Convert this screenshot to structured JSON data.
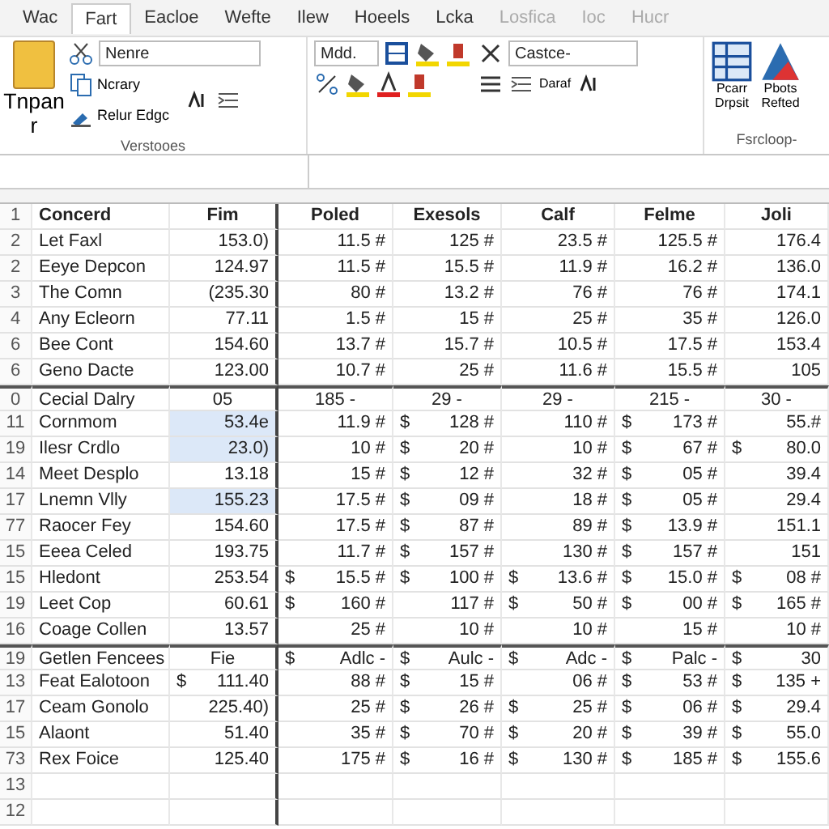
{
  "ribbon_tabs": [
    {
      "label": "Wac",
      "selected": false,
      "disabled": false
    },
    {
      "label": "Fart",
      "selected": true,
      "disabled": false
    },
    {
      "label": "Eacloe",
      "selected": false,
      "disabled": false
    },
    {
      "label": "Wefte",
      "selected": false,
      "disabled": false
    },
    {
      "label": "Ilew",
      "selected": false,
      "disabled": false
    },
    {
      "label": "Hoeels",
      "selected": false,
      "disabled": false
    },
    {
      "label": "Lcka",
      "selected": false,
      "disabled": false
    },
    {
      "label": "Losfica",
      "selected": false,
      "disabled": true
    },
    {
      "label": "Ioc",
      "selected": false,
      "disabled": true
    },
    {
      "label": "Hucr",
      "selected": false,
      "disabled": true
    }
  ],
  "ribbon": {
    "paste_label": "Tnpan",
    "paste_caret": "r",
    "clipboard_items": [
      "Ncrary",
      "Relur Edgc"
    ],
    "font_name": "Nenre",
    "font_size": "Mdd.",
    "number_format": "Castce-",
    "format_button": "Daraf",
    "right_buttons": [
      {
        "line1": "Pcarr",
        "line2": "Drpsit"
      },
      {
        "line1": "Pbots",
        "line2": "Refted"
      }
    ],
    "group_labels": [
      "Verstooes",
      "Fsrcloop-"
    ]
  },
  "sheet": {
    "rows": [
      {
        "kind": "header",
        "num": "1",
        "name": "Concerd",
        "amount": "Fim",
        "values": [
          "Poled",
          "Exesols",
          "Calf",
          "Felme",
          "Joli"
        ]
      },
      {
        "kind": "data",
        "num": "2",
        "name": "Let Faxl",
        "amount": "153.0)",
        "values": [
          "11.5 #",
          "125 #",
          "23.5 #",
          "125.5 #",
          "176.4"
        ]
      },
      {
        "kind": "data",
        "num": "2",
        "name": "Eeye Depcon",
        "amount": "124.97",
        "values": [
          "11.5 #",
          "15.5 #",
          "11.9 #",
          "16.2 #",
          "136.0"
        ]
      },
      {
        "kind": "data",
        "num": "3",
        "name": "The Comn",
        "amount": "(235.30",
        "values": [
          "80 #",
          "13.2 #",
          "76 #",
          "76 #",
          "174.1"
        ]
      },
      {
        "kind": "data",
        "num": "4",
        "name": "Any Ecleorn",
        "amount": "77.11",
        "values": [
          "1.5 #",
          "15 #",
          "25 #",
          "35 #",
          "126.0"
        ]
      },
      {
        "kind": "data",
        "num": "6",
        "name": "Bee Cont",
        "amount": "154.60",
        "values": [
          "13.7 #",
          "15.7 #",
          "10.5 #",
          "17.5 #",
          "153.4"
        ]
      },
      {
        "kind": "data",
        "num": "6",
        "name": "Geno Dacte",
        "amount": "123.00",
        "values": [
          "10.7 #",
          "25 #",
          "11.6 #",
          "15.5 #",
          "105"
        ]
      },
      {
        "kind": "section",
        "num": "0",
        "name": "Cecial Dalry",
        "amount": "05",
        "values": [
          "185 -",
          "29 -",
          "29 -",
          "215 -",
          "30 -"
        ]
      },
      {
        "kind": "data",
        "num": "11",
        "name": "Cornmom",
        "amount": "53.4e",
        "amount_selected": true,
        "values": [
          "11.9 #",
          {
            "prefix": "$",
            "text": "128 #"
          },
          "110 #",
          {
            "prefix": "$",
            "text": "173 #"
          },
          "55.#"
        ]
      },
      {
        "kind": "data",
        "num": "19",
        "name": "Ilesr Crdlo",
        "amount": "23.0)",
        "amount_selected": true,
        "values": [
          "10 #",
          {
            "prefix": "$",
            "text": "20 #"
          },
          "10 #",
          {
            "prefix": "$",
            "text": "67 #"
          },
          {
            "prefix": "$",
            "text": "80.0"
          }
        ]
      },
      {
        "kind": "data",
        "num": "14",
        "name": "Meet Desplo",
        "amount": "13.18",
        "amount_selected": false,
        "values": [
          "15 #",
          {
            "prefix": "$",
            "text": "12 #"
          },
          "32 #",
          {
            "prefix": "$",
            "text": "05 #"
          },
          "39.4"
        ]
      },
      {
        "kind": "data",
        "num": "17",
        "name": "Lnemn Vlly",
        "amount": "155.23",
        "amount_selected": true,
        "values": [
          "17.5 #",
          {
            "prefix": "$",
            "text": "09 #"
          },
          "18 #",
          {
            "prefix": "$",
            "text": "05 #"
          },
          "29.4"
        ]
      },
      {
        "kind": "data",
        "num": "77",
        "name": "Raocer Fey",
        "amount": "154.60",
        "amount_selected": false,
        "values": [
          "17.5 #",
          {
            "prefix": "$",
            "text": "87 #"
          },
          "89 #",
          {
            "prefix": "$",
            "text": "13.9 #"
          },
          "151.1"
        ]
      },
      {
        "kind": "data",
        "num": "15",
        "name": "Eeea Celed",
        "amount": "193.75",
        "amount_selected": false,
        "values": [
          "11.7 #",
          {
            "prefix": "$",
            "text": "157 #"
          },
          "130 #",
          {
            "prefix": "$",
            "text": "157 #"
          },
          "151"
        ]
      },
      {
        "kind": "data",
        "num": "15",
        "name": "Hledont",
        "amount": "253.54",
        "amount_selected": false,
        "values": [
          {
            "prefix": "$",
            "text": "15.5 #"
          },
          {
            "prefix": "$",
            "text": "100 #"
          },
          {
            "prefix": "$",
            "text": "13.6 #"
          },
          {
            "prefix": "$",
            "text": "15.0 #"
          },
          {
            "prefix": "$",
            "text": "08 #"
          }
        ]
      },
      {
        "kind": "data",
        "num": "19",
        "name": "Leet Cop",
        "amount": "60.61",
        "amount_selected": false,
        "values": [
          {
            "prefix": "$",
            "text": "160 #"
          },
          "117 #",
          {
            "prefix": "$",
            "text": "50 #"
          },
          {
            "prefix": "$",
            "text": "00 #"
          },
          {
            "prefix": "$",
            "text": "165 #"
          }
        ]
      },
      {
        "kind": "data",
        "num": "16",
        "name": "Coage Collen",
        "amount": "13.57",
        "amount_selected": false,
        "values": [
          "25 #",
          "10 #",
          "10 #",
          "15 #",
          "10 #"
        ]
      },
      {
        "kind": "subheader",
        "num": "19",
        "name": "Getlen Fencees",
        "amount": "Fie",
        "values": [
          {
            "prefix": "$",
            "text": "Adlc -"
          },
          {
            "prefix": "$",
            "text": "Aulc -"
          },
          {
            "prefix": "$",
            "text": "Adc -"
          },
          {
            "prefix": "$",
            "text": "Palc -"
          },
          {
            "prefix": "$",
            "text": "30"
          }
        ]
      },
      {
        "kind": "data",
        "num": "13",
        "name": "Feat Ealotoon",
        "amount": "111.40",
        "amount_prefix": "$",
        "values": [
          "88 #",
          {
            "prefix": "$",
            "text": "15 #"
          },
          "06 #",
          {
            "prefix": "$",
            "text": "53 #"
          },
          {
            "prefix": "$",
            "text": "135 +"
          }
        ]
      },
      {
        "kind": "data",
        "num": "17",
        "name": "Ceam Gonolo",
        "amount": "225.40)",
        "values": [
          "25 #",
          {
            "prefix": "$",
            "text": "26 #"
          },
          {
            "prefix": "$",
            "text": "25 #"
          },
          {
            "prefix": "$",
            "text": "06 #"
          },
          {
            "prefix": "$",
            "text": "29.4"
          }
        ]
      },
      {
        "kind": "data",
        "num": "15",
        "name": "Alaont",
        "amount": "51.40",
        "values": [
          "35 #",
          {
            "prefix": "$",
            "text": "70 #"
          },
          {
            "prefix": "$",
            "text": "20 #"
          },
          {
            "prefix": "$",
            "text": "39 #"
          },
          {
            "prefix": "$",
            "text": "55.0"
          }
        ]
      },
      {
        "kind": "data",
        "num": "73",
        "name": "Rex Foice",
        "amount": "125.40",
        "values": [
          "175 #",
          {
            "prefix": "$",
            "text": "16 #"
          },
          {
            "prefix": "$",
            "text": "130 #"
          },
          {
            "prefix": "$",
            "text": "185 #"
          },
          {
            "prefix": "$",
            "text": "155.6"
          }
        ]
      },
      {
        "kind": "empty",
        "num": "13"
      },
      {
        "kind": "empty",
        "num": "12"
      }
    ]
  }
}
